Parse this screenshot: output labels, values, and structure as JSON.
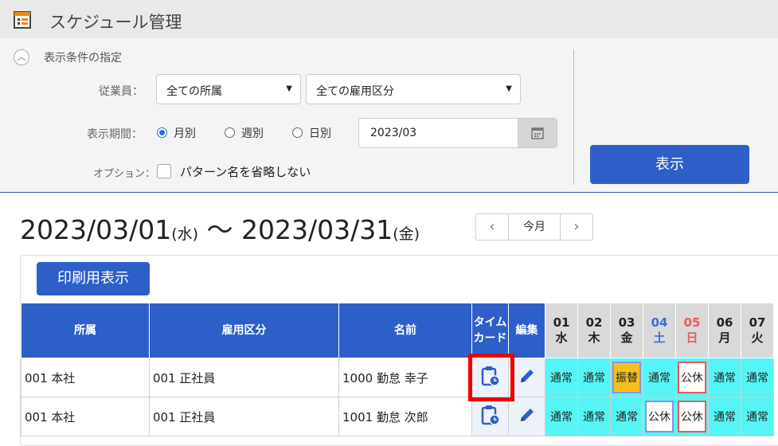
{
  "header": {
    "title": "スケジュール管理",
    "icon": "calendar-list-icon"
  },
  "filter": {
    "section_title": "表示条件の指定",
    "employee_label": "従業員：",
    "affiliation_select": "全ての所属",
    "employment_select": "全ての雇用区分",
    "period_label": "表示期間：",
    "period_options": [
      "月別",
      "週別",
      "日別"
    ],
    "period_selected": "月別",
    "date_value": "2023/03",
    "option_label": "オプション：",
    "option_checkbox_label": "パターン名を省略しない",
    "show_button": "表示"
  },
  "range": {
    "start": "2023/03/01",
    "start_dow": "(水)",
    "sep": "〜",
    "end": "2023/03/31",
    "end_dow": "(金)"
  },
  "nav": {
    "prev": "‹",
    "today": "今月",
    "next": "›"
  },
  "print_button": "印刷用表示",
  "table": {
    "headers": {
      "affiliation": "所属",
      "employment": "雇用区分",
      "name": "名前",
      "timecard_1": "タイム",
      "timecard_2": "カード",
      "edit": "編集"
    },
    "days": [
      {
        "d": "01",
        "w": "水"
      },
      {
        "d": "02",
        "w": "木"
      },
      {
        "d": "03",
        "w": "金"
      },
      {
        "d": "04",
        "w": "土"
      },
      {
        "d": "05",
        "w": "日"
      },
      {
        "d": "06",
        "w": "月"
      },
      {
        "d": "07",
        "w": "火"
      }
    ],
    "rows": [
      {
        "affiliation": "001 本社",
        "employment": "001 正社員",
        "name": "1000 勤怠 幸子",
        "shifts": [
          "通常",
          "通常",
          "振替",
          "通常",
          "公休",
          "通常",
          "通常"
        ]
      },
      {
        "affiliation": "001 本社",
        "employment": "001 正社員",
        "name": "1001 勤怠 次郎",
        "shifts": [
          "通常",
          "通常",
          "通常",
          "公休",
          "公休",
          "通常",
          "通常"
        ]
      }
    ]
  },
  "colors": {
    "accent": "#2e5fc9",
    "shift_normal": "#55f5f5",
    "shift_transfer": "#f4c01d",
    "saturday": "#3a6fd4",
    "sunday": "#ea5a5a",
    "highlight": "#ee0000"
  }
}
